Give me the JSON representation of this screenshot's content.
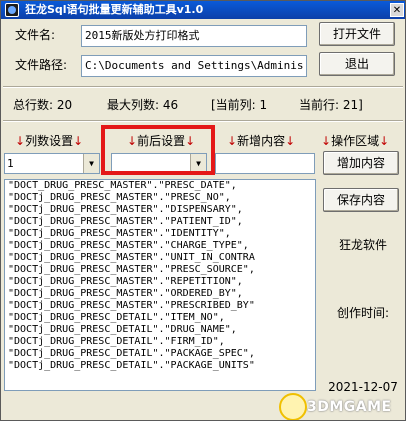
{
  "window": {
    "title": "狂龙Sql语句批量更新辅助工具v1.0",
    "close_glyph": "✕"
  },
  "file": {
    "name_label": "文件名:",
    "name_value": "2015新版处方打印格式",
    "path_label": "文件路径:",
    "path_value": "C:\\Documents and Settings\\Adminis"
  },
  "buttons": {
    "open_file": "打开文件",
    "exit": "退出",
    "add_content": "增加内容",
    "save_content": "保存内容"
  },
  "stats": {
    "total_rows": "总行数: 20",
    "max_cols": "最大列数: 46",
    "current_col": "[当前列: 1",
    "current_row": "当前行: 21]"
  },
  "groups": {
    "col_settings": "列数设置",
    "prefix_settings": "前后设置",
    "new_content": "新增内容",
    "ops_area": "操作区域",
    "arrow": "↓"
  },
  "combos": {
    "col_value": "1",
    "prefix_value": "",
    "dropdown_glyph": "▼"
  },
  "list_rows": [
    "\"DOCT_DRUG_PRESC_MASTER\".\"PRESC_DATE\",",
    "\"DOCTj_DRUG_PRESC_MASTER\".\"PRESC_NO\",",
    "\"DOCTj_DRUG_PRESC_MASTER\".\"DISPENSARY\",",
    "\"DOCTj_DRUG_PRESC_MASTER\".\"PATIENT_ID\",",
    "\"DOCTj_DRUG_PRESC_MASTER\".\"IDENTITY\",",
    "\"DOCTj_DRUG_PRESC_MASTER\".\"CHARGE_TYPE\",",
    "\"DOCTj_DRUG_PRESC_MASTER\".\"UNIT_IN_CONTRA",
    "\"DOCTj_DRUG_PRESC_MASTER\".\"PRESC_SOURCE\",",
    "\"DOCTj_DRUG_PRESC_MASTER\".\"REPETITION\",",
    "\"DOCTj_DRUG_PRESC_MASTER\".\"ORDERED_BY\",",
    "\"DOCTj_DRUG_PRESC_MASTER\".\"PRESCRIBED_BY\"",
    "\"DOCTj_DRUG_PRESC_DETAIL\".\"ITEM_NO\",",
    "\"DOCTj_DRUG_PRESC_DETAIL\".\"DRUG_NAME\",",
    "\"DOCTj_DRUG_PRESC_DETAIL\".\"FIRM_ID\",",
    "\"DOCTj_DRUG_PRESC_DETAIL\".\"PACKAGE_SPEC\",",
    "\"DOCTj_DRUG_PRESC_DETAIL\".\"PACKAGE_UNITS\""
  ],
  "side": {
    "brand": "狂龙软件",
    "created_label": "创作时间:",
    "date": "2021-12-07"
  },
  "watermark": {
    "text": "3DMGAME"
  },
  "colors": {
    "highlight": "#e41818",
    "arrow": "#c00000",
    "titlebar": "#0b3fa9"
  }
}
